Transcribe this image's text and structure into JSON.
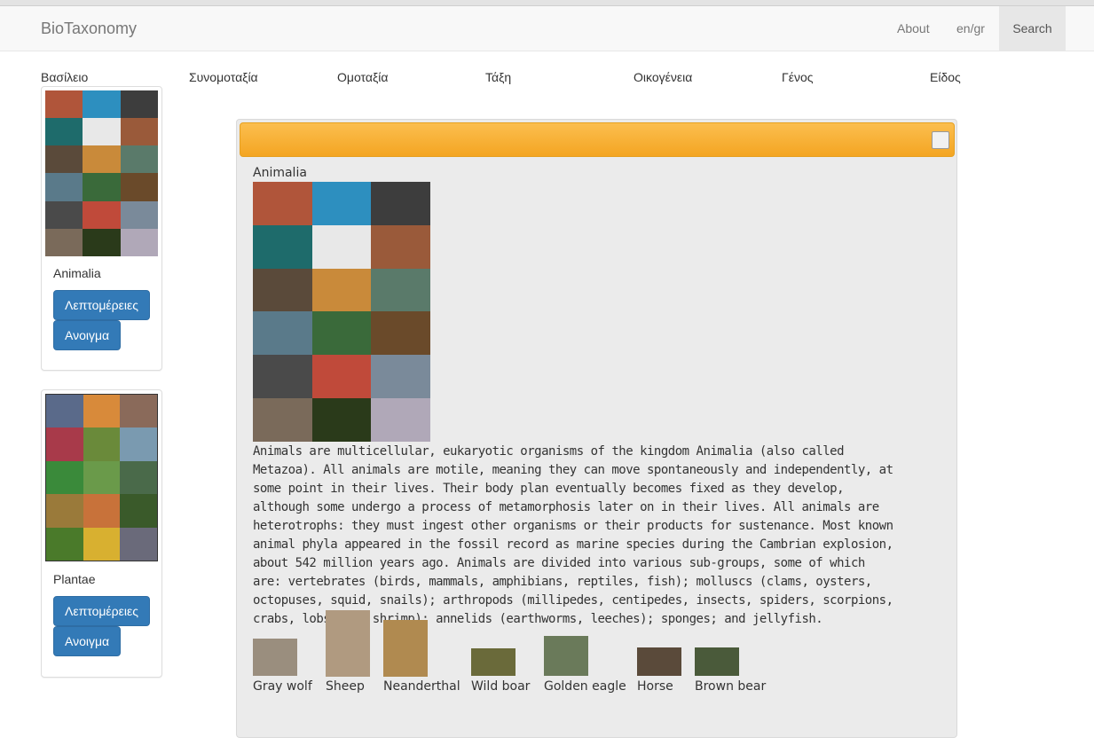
{
  "app": {
    "brand": "BioTaxonomy"
  },
  "nav": {
    "about": "About",
    "lang": "en/gr",
    "search": "Search"
  },
  "ranks": [
    "Βασίλειο",
    "Συνομοταξία",
    "Ομοταξία",
    "Τάξη",
    "Οικογένεια",
    "Γένος",
    "Είδος"
  ],
  "cards": [
    {
      "title": "Animalia",
      "details_label": "Λεπτομέρειες",
      "open_label": "Ανοιγμα",
      "tile_colors": [
        "#b0553a",
        "#2d8fbf",
        "#3d3d3d",
        "#1e6b6b",
        "#e8e8e8",
        "#9a5a3a",
        "#5a4a3a",
        "#c98a3a",
        "#5a7a6a",
        "#5a7a8a",
        "#3a6a3a",
        "#6a4a2a",
        "#4a4a4a",
        "#c04a3a",
        "#7a8a9a",
        "#7a6a5a",
        "#2a3a1a",
        "#b0a8b8"
      ]
    },
    {
      "title": "Plantae",
      "details_label": "Λεπτομέρειες",
      "open_label": "Ανοιγμα",
      "tile_colors": [
        "#5a6a8a",
        "#d88a3a",
        "#8a6a5a",
        "#a83a4a",
        "#6a8a3a",
        "#7a9ab0",
        "#3a8a3a",
        "#6a9a4a",
        "#4a6a4a",
        "#9a7a3a",
        "#c8723a",
        "#3a5a2a",
        "#4a7a2a",
        "#d8b030",
        "#6a6a7a"
      ]
    }
  ],
  "panel": {
    "title": "Animalia",
    "mosaic_colors": [
      "#b0553a",
      "#2d8fbf",
      "#3d3d3d",
      "#1e6b6b",
      "#e8e8e8",
      "#9a5a3a",
      "#5a4a3a",
      "#c98a3a",
      "#5a7a6a",
      "#5a7a8a",
      "#3a6a3a",
      "#6a4a2a",
      "#4a4a4a",
      "#c04a3a",
      "#7a8a9a",
      "#7a6a5a",
      "#2a3a1a",
      "#b0a8b8"
    ],
    "description": "Animals are multicellular, eukaryotic organisms of the kingdom Animalia (also called Metazoa). All animals are motile, meaning they can move spontaneously and independently, at some point in their lives. Their body plan eventually becomes fixed as they develop, although some undergo a process of metamorphosis later on in their lives. All animals are heterotrophs: they must ingest other organisms or their products for sustenance. Most known animal phyla appeared in the fossil record as marine species during the Cambrian explosion, about 542 million years ago. Animals are divided into various sub-groups, some of which are: vertebrates (birds, mammals, amphibians, reptiles, fish); molluscs (clams, oysters, octopuses, squid, snails); arthropods (millipedes, centipedes, insects, spiders, scorpions, crabs, lobsters, shrimp); annelids (earthworms, leeches); sponges; and jellyfish.",
    "examples": [
      {
        "name": "Gray wolf",
        "color": "#9a8e7e"
      },
      {
        "name": "Sheep",
        "color": "#b09a80"
      },
      {
        "name": "Neanderthal",
        "color": "#b08a50"
      },
      {
        "name": "Wild boar",
        "color": "#6a6a3a"
      },
      {
        "name": "Golden eagle",
        "color": "#6a7a5a"
      },
      {
        "name": "Horse",
        "color": "#5a4a3a"
      },
      {
        "name": "Brown bear",
        "color": "#4a5a3a"
      }
    ]
  }
}
